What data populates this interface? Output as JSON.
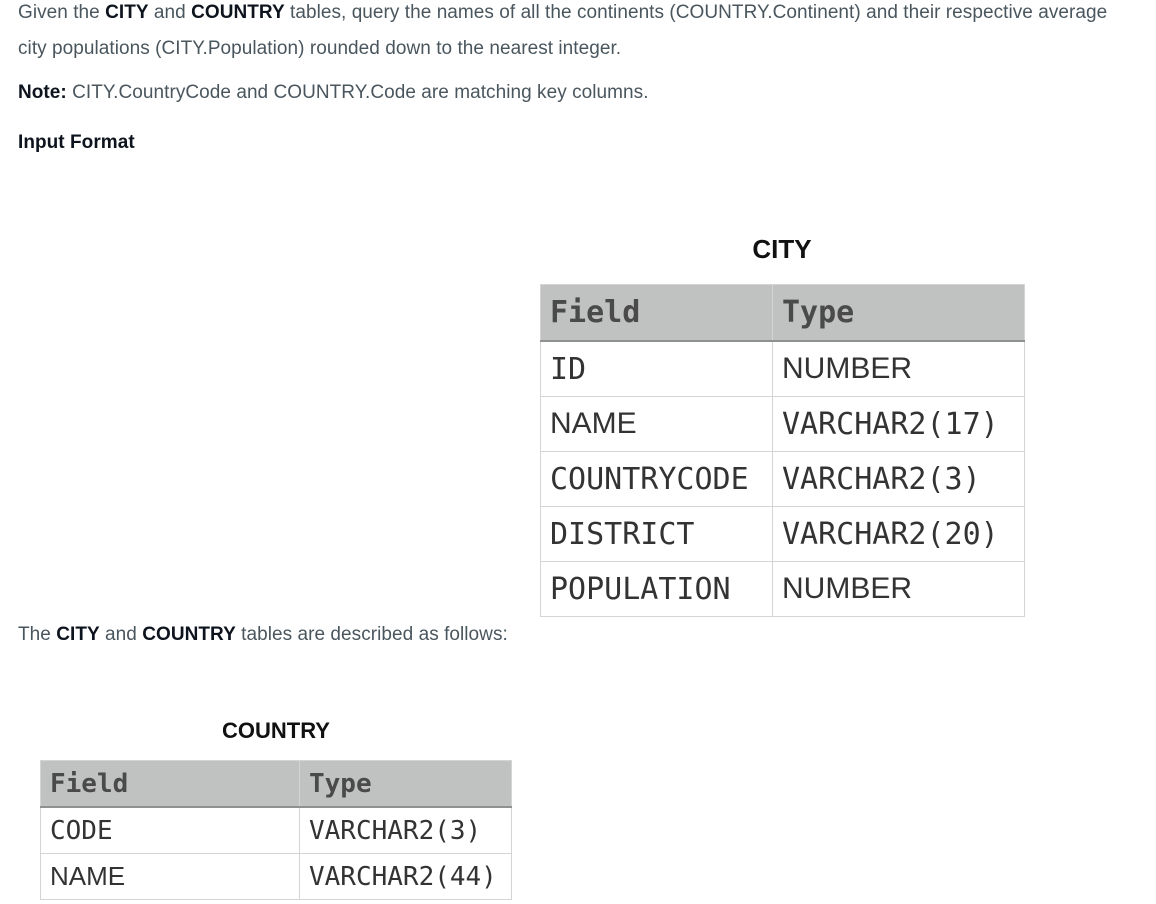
{
  "intro": {
    "t1": "Given the ",
    "city": "CITY",
    "t2": " and ",
    "country": "COUNTRY",
    "t3": " tables, query the names of all the continents (COUNTRY.Continent) and their respective average",
    "line2": "city populations (CITY.Population) rounded down to the nearest integer."
  },
  "note": {
    "label": "Note:",
    "text": " CITY.CountryCode and COUNTRY.Code are matching key columns."
  },
  "input_format": {
    "heading": "Input Format"
  },
  "described": {
    "t1": "The ",
    "city": "CITY",
    "t2": " and ",
    "country": "COUNTRY",
    "t3": " tables are described as follows:"
  },
  "city_table": {
    "caption": "CITY",
    "headers": [
      "Field",
      "Type"
    ],
    "rows": [
      [
        "ID",
        "NUMBER"
      ],
      [
        "NAME",
        "VARCHAR2(17)"
      ],
      [
        "COUNTRYCODE",
        "VARCHAR2(3)"
      ],
      [
        "DISTRICT",
        "VARCHAR2(20)"
      ],
      [
        "POPULATION",
        "NUMBER"
      ]
    ]
  },
  "country_table": {
    "caption": "COUNTRY",
    "headers": [
      "Field",
      "Type"
    ],
    "rows": [
      [
        "CODE",
        "VARCHAR2(3)"
      ],
      [
        "NAME",
        "VARCHAR2(44)"
      ]
    ]
  }
}
